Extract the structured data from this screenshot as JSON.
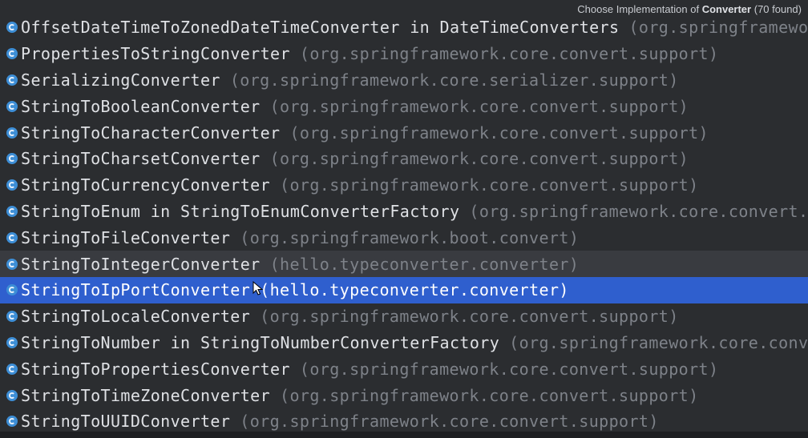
{
  "header": {
    "prefix": "Choose Implementation of",
    "target": "Converter",
    "count": "(70 found)"
  },
  "items": [
    {
      "name": "OffsetDateTimeToZonedDateTimeConverter in DateTimeConverters",
      "pkg": "(org.springframework.format.datetime.standard)",
      "state": "normal"
    },
    {
      "name": "PropertiesToStringConverter",
      "pkg": "(org.springframework.core.convert.support)",
      "state": "normal"
    },
    {
      "name": "SerializingConverter",
      "pkg": "(org.springframework.core.serializer.support)",
      "state": "normal"
    },
    {
      "name": "StringToBooleanConverter",
      "pkg": "(org.springframework.core.convert.support)",
      "state": "normal"
    },
    {
      "name": "StringToCharacterConverter",
      "pkg": "(org.springframework.core.convert.support)",
      "state": "normal"
    },
    {
      "name": "StringToCharsetConverter",
      "pkg": "(org.springframework.core.convert.support)",
      "state": "normal"
    },
    {
      "name": "StringToCurrencyConverter",
      "pkg": "(org.springframework.core.convert.support)",
      "state": "normal"
    },
    {
      "name": "StringToEnum in StringToEnumConverterFactory",
      "pkg": "(org.springframework.core.convert.support)",
      "state": "normal"
    },
    {
      "name": "StringToFileConverter",
      "pkg": "(org.springframework.boot.convert)",
      "state": "normal"
    },
    {
      "name": "StringToIntegerConverter",
      "pkg": "(hello.typeconverter.converter)",
      "state": "hover"
    },
    {
      "name": "StringToIpPortConverter",
      "pkg": "(hello.typeconverter.converter)",
      "state": "selected"
    },
    {
      "name": "StringToLocaleConverter",
      "pkg": "(org.springframework.core.convert.support)",
      "state": "normal"
    },
    {
      "name": "StringToNumber in StringToNumberConverterFactory",
      "pkg": "(org.springframework.core.convert.support)",
      "state": "normal"
    },
    {
      "name": "StringToPropertiesConverter",
      "pkg": "(org.springframework.core.convert.support)",
      "state": "normal"
    },
    {
      "name": "StringToTimeZoneConverter",
      "pkg": "(org.springframework.core.convert.support)",
      "state": "normal"
    },
    {
      "name": "StringToUUIDConverter",
      "pkg": "(org.springframework.core.convert.support)",
      "state": "normal"
    }
  ],
  "colors": {
    "background": "#2b2d30",
    "selection": "#2f5fce",
    "hover": "#393b40",
    "class_icon": "#3d8ed6",
    "name_text": "#dfe1e5",
    "package_text": "#7e8289"
  },
  "icons": {
    "item_icon": "class-icon",
    "pointer": "mouse-pointer-icon"
  }
}
